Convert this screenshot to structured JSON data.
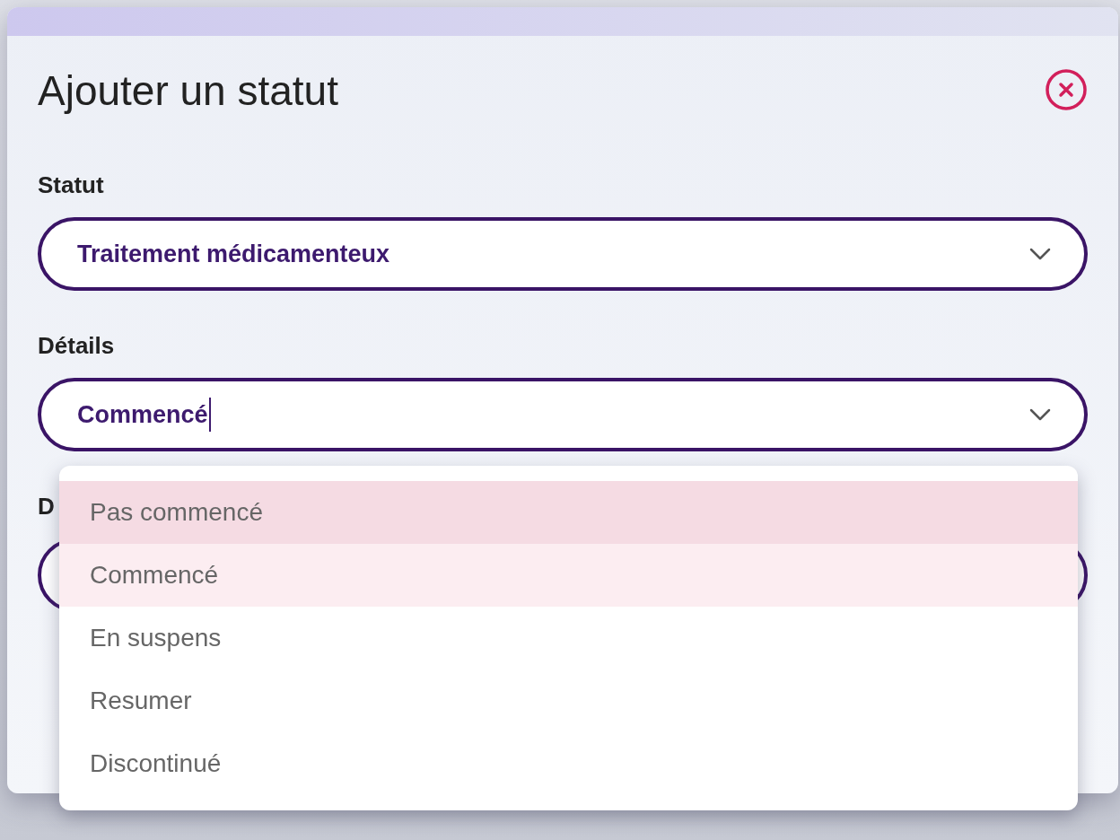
{
  "dialog": {
    "title": "Ajouter un statut"
  },
  "fields": [
    {
      "label": "Statut",
      "value": "Traitement médicamenteux"
    },
    {
      "label": "Détails",
      "value": "Commencé",
      "focused": true
    },
    {
      "label": "D"
    }
  ],
  "dropdown": {
    "options": [
      {
        "label": "Pas commencé",
        "highlighted": true,
        "selected": false
      },
      {
        "label": "Commencé",
        "highlighted": false,
        "selected": true
      },
      {
        "label": "En suspens",
        "highlighted": false,
        "selected": false
      },
      {
        "label": "Resumer",
        "highlighted": false,
        "selected": false
      },
      {
        "label": "Discontinué",
        "highlighted": false,
        "selected": false
      }
    ]
  }
}
